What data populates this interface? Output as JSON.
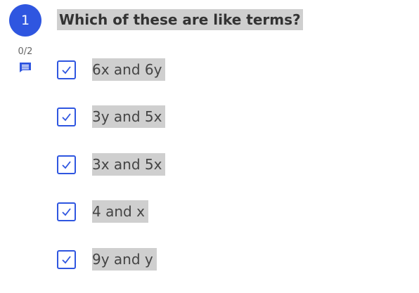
{
  "question": {
    "number": "1",
    "text": "Which of these are like terms?",
    "score": "0/2"
  },
  "options": [
    {
      "label": "6x and 6y",
      "checked": true
    },
    {
      "label": "3y and 5x",
      "checked": true
    },
    {
      "label": "3x and 5x",
      "checked": true
    },
    {
      "label": "4 and x",
      "checked": true
    },
    {
      "label": "9y and y",
      "checked": true
    }
  ],
  "colors": {
    "accent": "#2f56e0",
    "highlight": "#cfcfcf"
  },
  "icons": {
    "comment": "comment-icon",
    "check": "check-icon"
  }
}
